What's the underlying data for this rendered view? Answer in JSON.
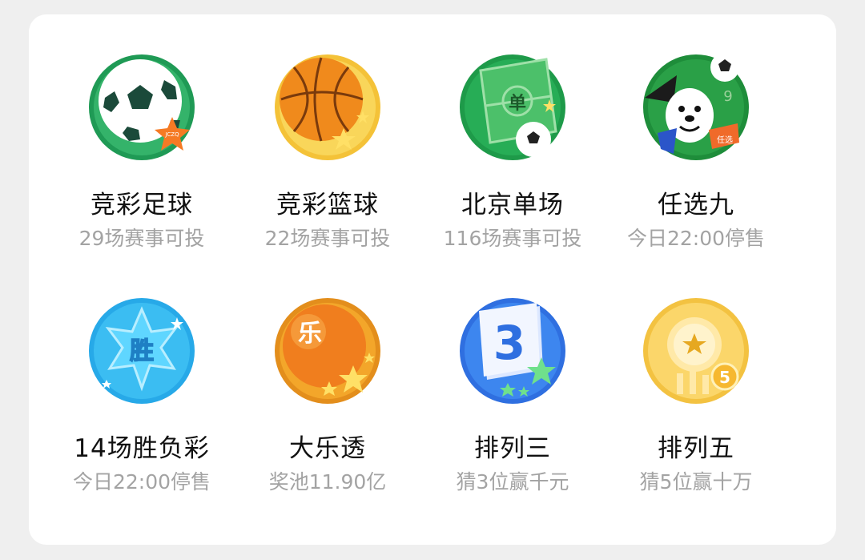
{
  "games": [
    {
      "name": "竞彩足球",
      "subtitle": "29场赛事可投",
      "icon": "soccer-ball-icon"
    },
    {
      "name": "竞彩篮球",
      "subtitle": "22场赛事可投",
      "icon": "basketball-icon"
    },
    {
      "name": "北京单场",
      "subtitle": "116场赛事可投",
      "icon": "soccer-field-icon",
      "badge": "单"
    },
    {
      "name": "任选九",
      "subtitle": "今日22:00停售",
      "icon": "mascot-goal-icon",
      "badge": "9"
    },
    {
      "name": "14场胜负彩",
      "subtitle": "今日22:00停售",
      "icon": "victory-star-icon",
      "badge": "胜"
    },
    {
      "name": "大乐透",
      "subtitle": "奖池11.90亿",
      "icon": "lotto-ball-icon",
      "badge": "乐"
    },
    {
      "name": "排列三",
      "subtitle": "猜3位赢千元",
      "icon": "number-three-card-icon",
      "badge": "3"
    },
    {
      "name": "排列五",
      "subtitle": "猜5位赢十万",
      "icon": "gold-coin-icon",
      "badge": "5"
    }
  ],
  "colors": {
    "background": "#efefef",
    "card": "#ffffff",
    "title": "#111111",
    "subtitle": "#a3a3a3",
    "green": "#1fa34a",
    "orange": "#f08a1c",
    "blue": "#2f8fe6",
    "gold": "#f6c23a"
  }
}
